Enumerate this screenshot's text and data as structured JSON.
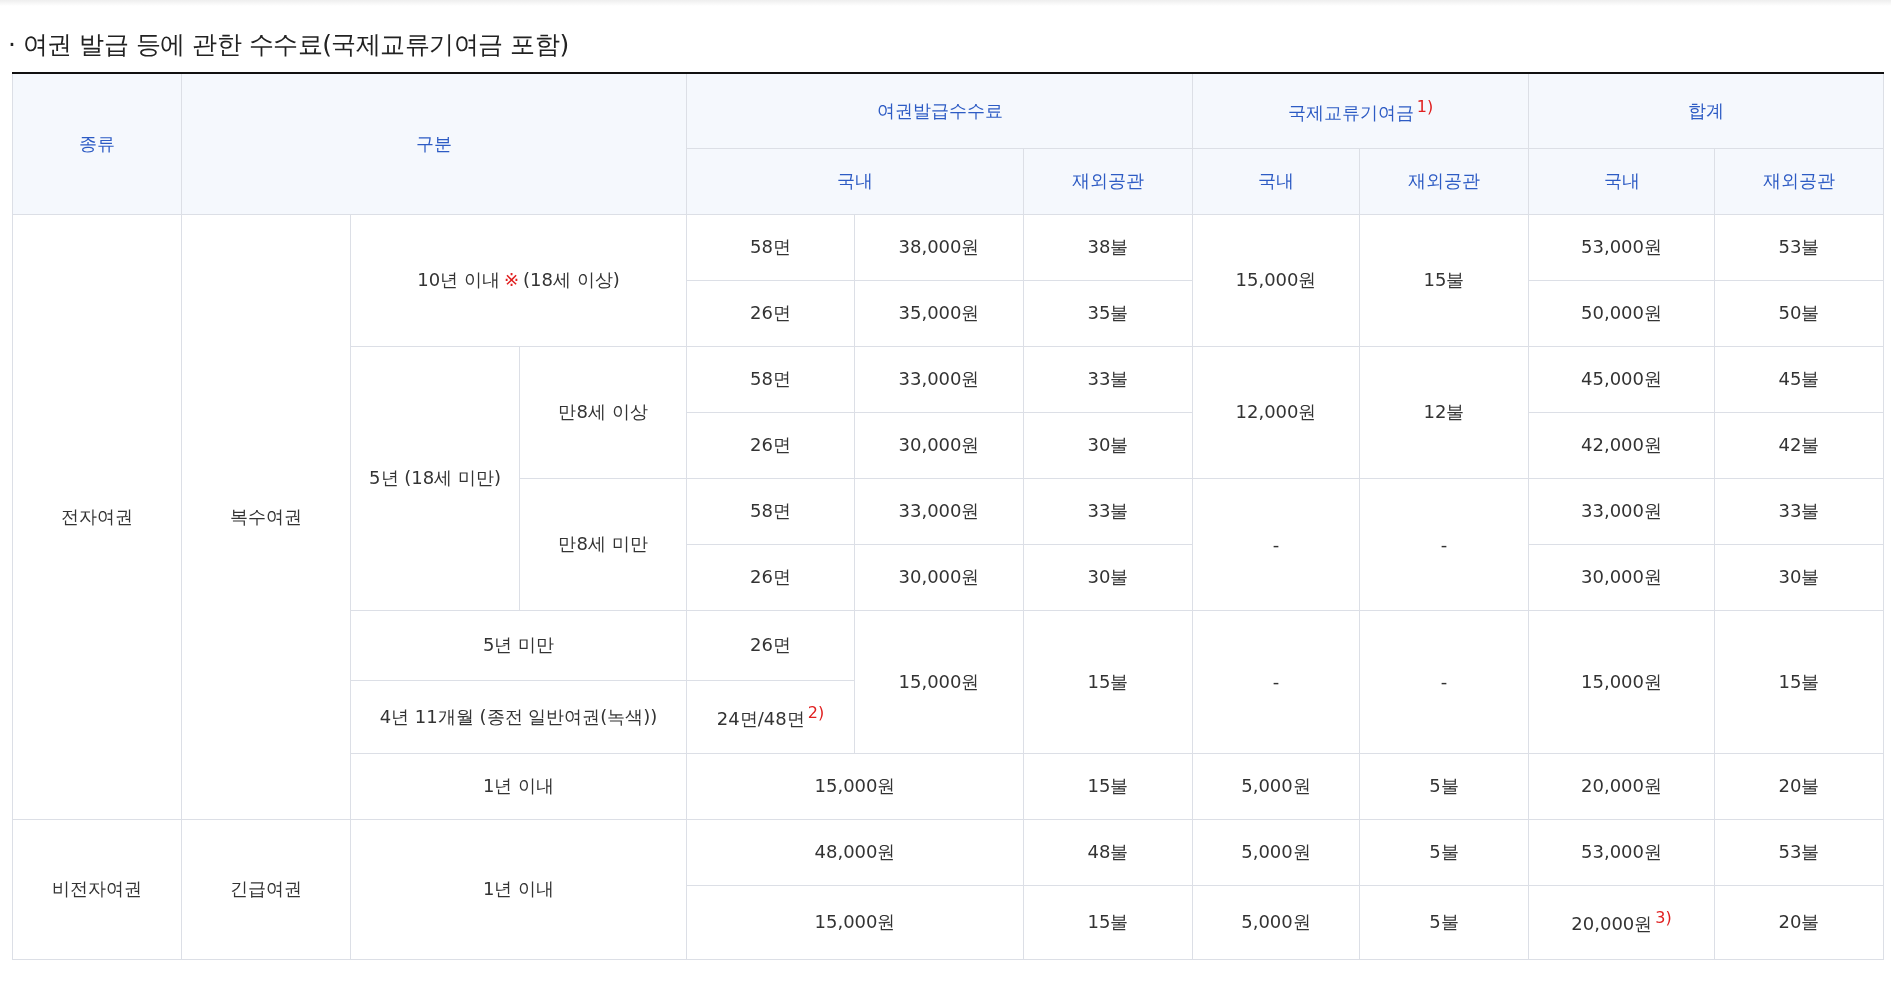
{
  "title": "· 여권 발급 등에 관한 수수료(국제교류기여금 포함)",
  "header_rows": [
    [
      {
        "text": "종류",
        "rowspan": 2
      },
      {
        "text": "구분",
        "rowspan": 2,
        "colspan": 3
      },
      {
        "text": "여권발급수수료",
        "colspan": 3
      },
      {
        "text": "국제교류기여금",
        "note": "1)",
        "colspan": 2
      },
      {
        "text": "합계",
        "colspan": 2
      }
    ],
    [
      {
        "text": "국내",
        "colspan": 2
      },
      {
        "text": "재외공관"
      },
      {
        "text": "국내"
      },
      {
        "text": "재외공관"
      },
      {
        "text": "국내"
      },
      {
        "text": "재외공관"
      }
    ]
  ],
  "rows": [
    [
      {
        "text": "전자여권",
        "rowspan": 9
      },
      {
        "text": "복수여권",
        "rowspan": 9
      },
      {
        "text": "10년 이내",
        "mark": "※",
        "text_after": "(18세 이상)",
        "colspan": 2,
        "rowspan": 2
      },
      {
        "text": "58면"
      },
      {
        "text": "38,000원"
      },
      {
        "text": "38불"
      },
      {
        "text": "15,000원",
        "rowspan": 2
      },
      {
        "text": "15불",
        "rowspan": 2
      },
      {
        "text": "53,000원"
      },
      {
        "text": "53불"
      }
    ],
    [
      {
        "text": "26면"
      },
      {
        "text": "35,000원"
      },
      {
        "text": "35불"
      },
      {
        "text": "50,000원"
      },
      {
        "text": "50불"
      }
    ],
    [
      {
        "text": "5년 (18세 미만)",
        "rowspan": 4
      },
      {
        "text": "만8세 이상",
        "rowspan": 2
      },
      {
        "text": "58면"
      },
      {
        "text": "33,000원"
      },
      {
        "text": "33불"
      },
      {
        "text": "12,000원",
        "rowspan": 2
      },
      {
        "text": "12불",
        "rowspan": 2
      },
      {
        "text": "45,000원"
      },
      {
        "text": "45불"
      }
    ],
    [
      {
        "text": "26면"
      },
      {
        "text": "30,000원"
      },
      {
        "text": "30불"
      },
      {
        "text": "42,000원"
      },
      {
        "text": "42불"
      }
    ],
    [
      {
        "text": "만8세 미만",
        "rowspan": 2
      },
      {
        "text": "58면"
      },
      {
        "text": "33,000원"
      },
      {
        "text": "33불"
      },
      {
        "text": "-",
        "rowspan": 2
      },
      {
        "text": "-",
        "rowspan": 2
      },
      {
        "text": "33,000원"
      },
      {
        "text": "33불"
      }
    ],
    [
      {
        "text": "26면"
      },
      {
        "text": "30,000원"
      },
      {
        "text": "30불"
      },
      {
        "text": "30,000원"
      },
      {
        "text": "30불"
      }
    ],
    [
      {
        "text": "5년 미만",
        "colspan": 2
      },
      {
        "text": "26면"
      },
      {
        "text": "15,000원",
        "rowspan": 2
      },
      {
        "text": "15불",
        "rowspan": 2
      },
      {
        "text": "-",
        "rowspan": 2
      },
      {
        "text": "-",
        "rowspan": 2
      },
      {
        "text": "15,000원",
        "rowspan": 2
      },
      {
        "text": "15불",
        "rowspan": 2
      }
    ],
    [
      {
        "text": "4년 11개월 (종전 일반여권(녹색))",
        "colspan": 2
      },
      {
        "text": "24면/48면",
        "note": "2)"
      }
    ],
    [
      {
        "text": "1년 이내",
        "colspan": 2
      },
      {
        "text": "15,000원",
        "colspan": 2
      },
      {
        "text": "15불"
      },
      {
        "text": "5,000원"
      },
      {
        "text": "5불"
      },
      {
        "text": "20,000원"
      },
      {
        "text": "20불"
      }
    ],
    [
      {
        "text": "비전자여권",
        "rowspan": 2
      },
      {
        "text": "긴급여권",
        "rowspan": 2
      },
      {
        "text": "1년 이내",
        "colspan": 2,
        "rowspan": 2
      },
      {
        "text": "48,000원",
        "colspan": 2
      },
      {
        "text": "48불"
      },
      {
        "text": "5,000원"
      },
      {
        "text": "5불"
      },
      {
        "text": "53,000원"
      },
      {
        "text": "53불"
      }
    ],
    [
      {
        "text": "15,000원",
        "colspan": 2
      },
      {
        "text": "15불"
      },
      {
        "text": "5,000원"
      },
      {
        "text": "5불"
      },
      {
        "text": "20,000원",
        "note": "3)"
      },
      {
        "text": "20불"
      }
    ]
  ]
}
